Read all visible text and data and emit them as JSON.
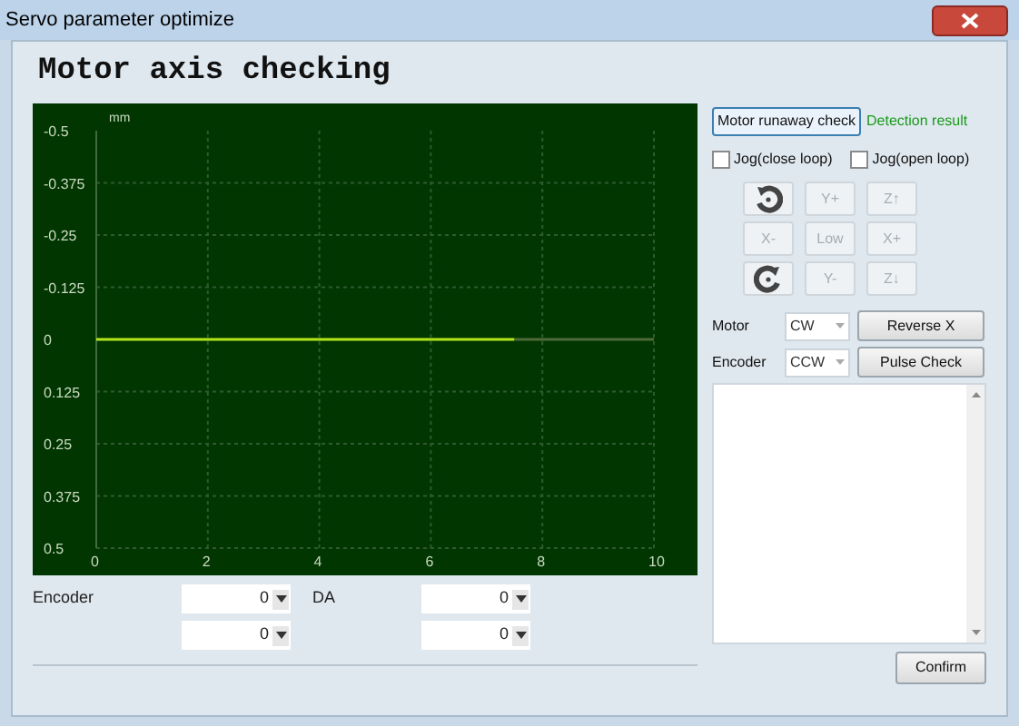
{
  "window": {
    "title": "Servo parameter optimize"
  },
  "heading": "Motor axis checking",
  "chart": {
    "chart_data": {
      "type": "line",
      "ylabel": "mm",
      "x": [
        0,
        7.5,
        10
      ],
      "series": [
        {
          "color": "#b5e61d",
          "values": [
            0,
            0,
            null
          ]
        },
        {
          "color": "#4f6b3a",
          "values": [
            null,
            0,
            0
          ]
        }
      ],
      "grid": true,
      "xlim": [
        0,
        10
      ],
      "ylim": [
        0.5,
        -0.5
      ],
      "xticks": [
        0,
        2,
        4,
        6,
        8,
        10
      ],
      "yticks": [
        -0.5,
        -0.375,
        -0.25,
        -0.125,
        0,
        0.125,
        0.25,
        0.375,
        0.5
      ]
    }
  },
  "readouts": [
    {
      "label": "Encoder",
      "value": "0"
    },
    {
      "label": "DA",
      "value": "0"
    },
    {
      "value": "0"
    },
    {
      "value": "0"
    }
  ],
  "runaway_button": "Motor runaway check",
  "detection_result": "Detection result",
  "checkboxes": [
    {
      "label": "Jog(close loop)",
      "checked": false
    },
    {
      "label": "Jog(open loop)",
      "checked": false
    }
  ],
  "jog_buttons": [
    {
      "kind": "rotate_cw",
      "disabled": false
    },
    {
      "kind": "text",
      "label": "Y+",
      "disabled": true
    },
    {
      "kind": "text",
      "label": "Z↑",
      "disabled": true
    },
    {
      "kind": "text",
      "label": "X-",
      "disabled": true
    },
    {
      "kind": "text",
      "label": "Low",
      "disabled": true
    },
    {
      "kind": "text",
      "label": "X+",
      "disabled": true
    },
    {
      "kind": "rotate_ccw",
      "disabled": false
    },
    {
      "kind": "text",
      "label": "Y-",
      "disabled": true
    },
    {
      "kind": "text",
      "label": "Z↓",
      "disabled": true
    }
  ],
  "direction_rows": [
    {
      "label": "Motor",
      "value": "CW",
      "button": "Reverse X"
    },
    {
      "label": "Encoder",
      "value": "CCW",
      "button": "Pulse Check"
    }
  ],
  "confirm_button": "Confirm"
}
